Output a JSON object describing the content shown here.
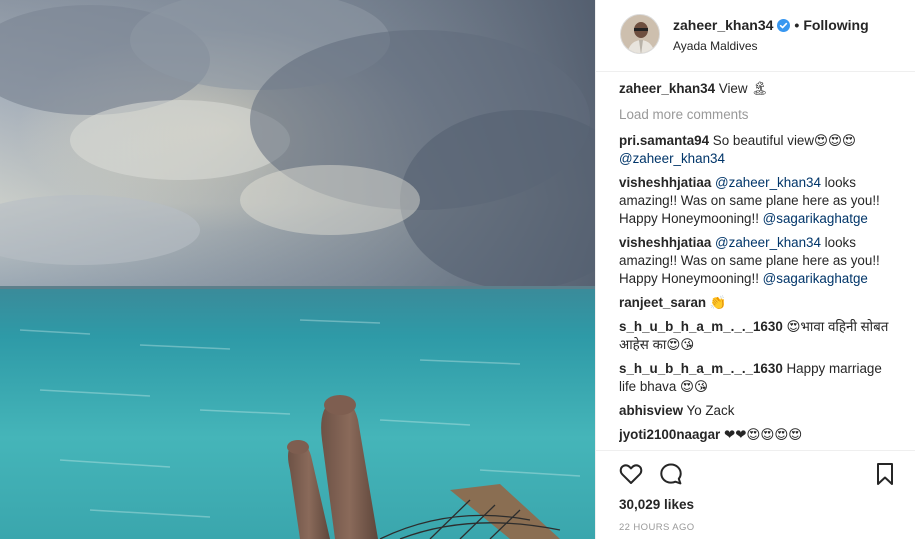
{
  "post": {
    "author": {
      "username": "zaheer_khan34",
      "separator": "•",
      "follow_status": "Following",
      "location": "Ayada Maldives"
    },
    "caption": {
      "username": "zaheer_khan34",
      "text": "View 🏝"
    },
    "load_more": "Load more comments",
    "comments": [
      {
        "username": "pri.samanta94",
        "parts": [
          "So beautiful view😍😍😍 ",
          "@zaheer_khan34"
        ]
      },
      {
        "username": "visheshhjatiaa",
        "parts": [
          "@zaheer_khan34",
          " looks amazing!! Was on same plane here as you!! Happy Honeymooning!! ",
          "@sagarikaghatge"
        ]
      },
      {
        "username": "visheshhjatiaa",
        "parts": [
          "@zaheer_khan34",
          " looks amazing!! Was on same plane here as you!! Happy Honeymooning!! ",
          "@sagarikaghatge"
        ]
      },
      {
        "username": "ranjeet_saran",
        "parts": [
          "👏"
        ]
      },
      {
        "username": "s_h_u_b_h_a_m_._._1630",
        "parts": [
          "😍भावा वहिनी सोबत आहेस का😍😘"
        ]
      },
      {
        "username": "s_h_u_b_h_a_m_._._1630",
        "parts": [
          "Happy marriage life bhava 😍😘"
        ]
      },
      {
        "username": "abhisview",
        "parts": [
          "Yo Zack"
        ]
      },
      {
        "username": "jyoti2100naagar",
        "parts": [
          "❤❤😍😍😍😍"
        ]
      }
    ],
    "likes": "30,029 likes",
    "timestamp": "22 HOURS AGO"
  },
  "icons": {
    "like": "heart-icon",
    "comment": "comment-icon",
    "save": "bookmark-icon",
    "verified": "verified-badge-icon"
  },
  "colors": {
    "verified_blue": "#3897f0",
    "mention": "#003569",
    "muted": "#999999",
    "sea": "#3aa0a8"
  }
}
